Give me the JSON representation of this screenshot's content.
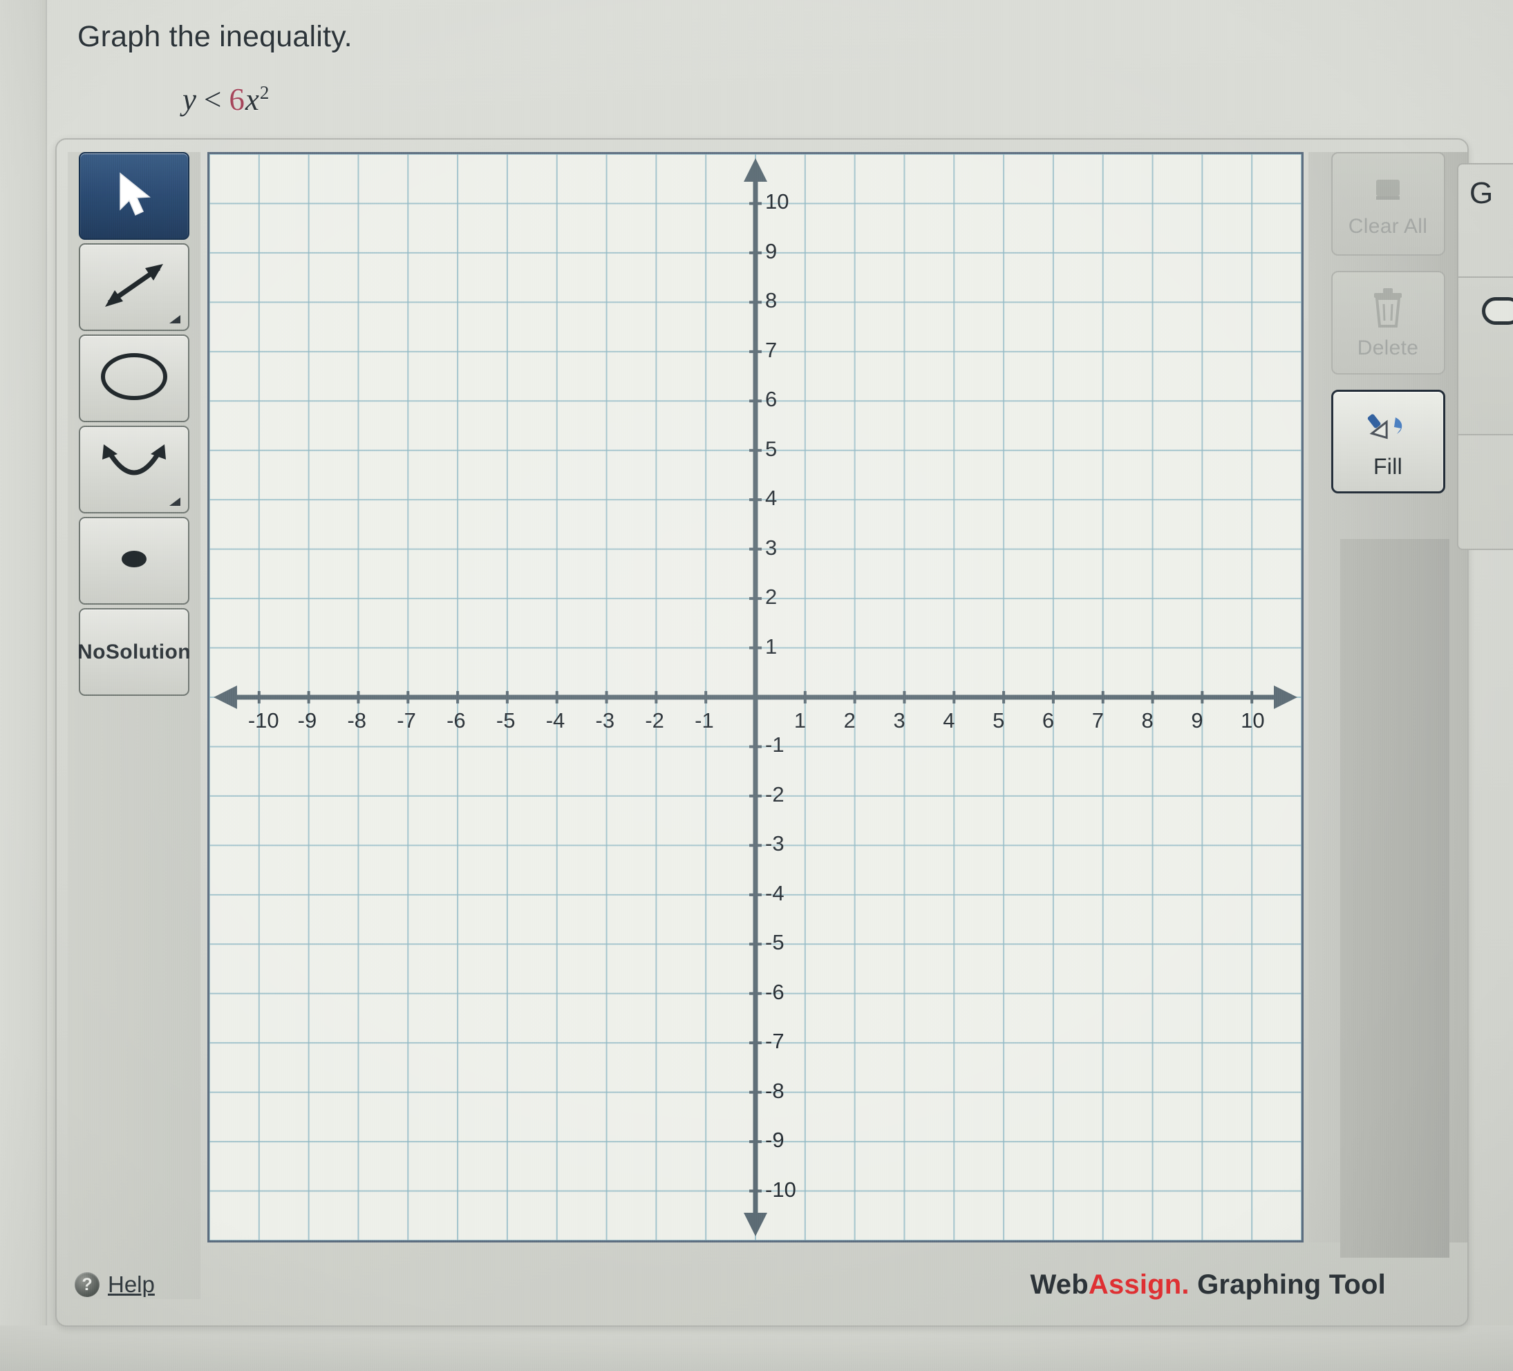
{
  "question": {
    "prompt": "Graph the inequality.",
    "equation": {
      "lhs": "y",
      "operator": "<",
      "coefficient": "6",
      "variable": "x",
      "exponent": "2",
      "full": "y < 6x²"
    }
  },
  "toolbar": {
    "items": [
      {
        "name": "pointer",
        "label": "Pointer",
        "icon": "cursor-arrow-icon",
        "selected": true
      },
      {
        "name": "line",
        "label": "Line",
        "icon": "double-arrow-line-icon",
        "selected": false
      },
      {
        "name": "circle",
        "label": "Circle",
        "icon": "ellipse-icon",
        "selected": false
      },
      {
        "name": "parabola",
        "label": "Parabola",
        "icon": "parabola-icon",
        "selected": false
      },
      {
        "name": "point",
        "label": "Point",
        "icon": "filled-dot-icon",
        "selected": false
      },
      {
        "name": "no-solution",
        "label": "No\nSolution",
        "icon": "",
        "selected": false
      }
    ],
    "no_solution_line1": "No",
    "no_solution_line2": "Solution",
    "help_label": "Help",
    "help_icon": "question-mark-circle-icon"
  },
  "actions": {
    "clear_all": {
      "label": "Clear All",
      "icon": "eraser-icon",
      "enabled": false
    },
    "delete": {
      "label": "Delete",
      "icon": "trash-can-icon",
      "enabled": false
    },
    "fill": {
      "label": "Fill",
      "icon": "paint-bucket-icon",
      "enabled": true
    }
  },
  "footer": {
    "brand_part1": "Web",
    "brand_part2": "Assign.",
    "brand_suffix": "Graphing Tool"
  },
  "offscreen": {
    "letter": "G"
  },
  "colors": {
    "accent_red": "#e03033",
    "coefficient_red": "#a6445a",
    "selected_tool_blue": "#2a4a72",
    "grid_line": "#8fb8c4",
    "axis_line": "#5a6a74",
    "canvas_bg": "#eef0ea"
  },
  "chart_data": {
    "type": "scatter",
    "title": "",
    "xlabel": "",
    "ylabel": "",
    "xlim": [
      -11,
      11
    ],
    "ylim": [
      -11,
      11
    ],
    "grid": true,
    "grid_step": 1,
    "legend": "none",
    "x_ticks": [
      -10,
      -9,
      -8,
      -7,
      -6,
      -5,
      -4,
      -3,
      -2,
      -1,
      1,
      2,
      3,
      4,
      5,
      6,
      7,
      8,
      9,
      10
    ],
    "y_ticks": [
      10,
      9,
      8,
      7,
      6,
      5,
      4,
      3,
      2,
      1,
      -1,
      -2,
      -3,
      -4,
      -5,
      -6,
      -7,
      -8,
      -9,
      -10
    ],
    "x_tick_labels": [
      "-10",
      "-9",
      "-8",
      "-7",
      "-6",
      "-5",
      "-4",
      "-3",
      "-2",
      "-1",
      "1",
      "2",
      "3",
      "4",
      "5",
      "6",
      "7",
      "8",
      "9",
      "10"
    ],
    "y_tick_labels": [
      "10",
      "9",
      "8",
      "7",
      "6",
      "5",
      "4",
      "3",
      "2",
      "1",
      "-1",
      "-2",
      "-3",
      "-4",
      "-5",
      "-6",
      "-7",
      "-8",
      "-9",
      "-10"
    ],
    "axis_arrows": [
      "left",
      "right",
      "up",
      "down"
    ],
    "series": [],
    "annotations": [],
    "note": "Empty coordinate plane — no curve or shading has been drawn yet."
  }
}
